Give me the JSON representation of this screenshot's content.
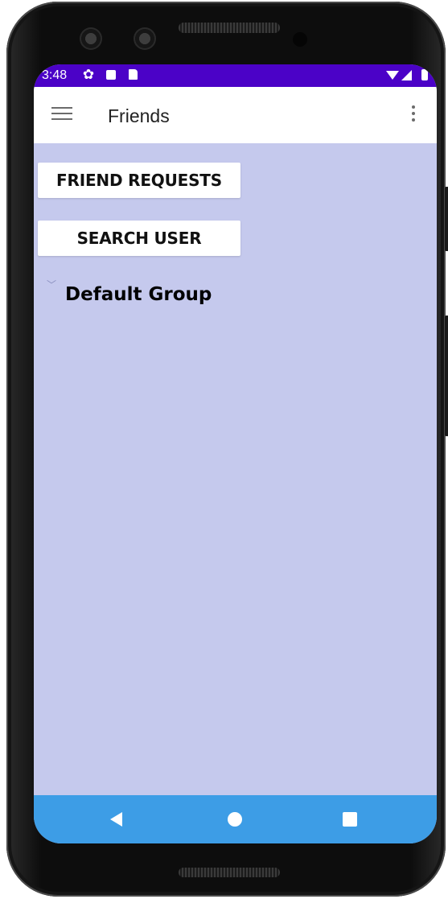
{
  "status_bar": {
    "time": "3:48",
    "background_color": "#4b02c7",
    "icons": [
      "gear-icon",
      "a-box-icon",
      "sd-card-icon",
      "wifi-icon",
      "signal-icon",
      "battery-icon"
    ]
  },
  "app_bar": {
    "title": "Friends",
    "menu_icon": "hamburger-menu-icon",
    "overflow_icon": "more-vertical-icon"
  },
  "main": {
    "background_color": "#c5c9ed",
    "friend_requests_label": "FRIEND REQUESTS",
    "search_user_label": "SEARCH USER",
    "group": {
      "label": "Default Group",
      "chevron_icon": "chevron-down-icon",
      "expanded": true
    }
  },
  "nav_bar": {
    "background_color": "#3d9de6",
    "buttons": [
      "back-icon",
      "home-icon",
      "recents-icon"
    ]
  }
}
